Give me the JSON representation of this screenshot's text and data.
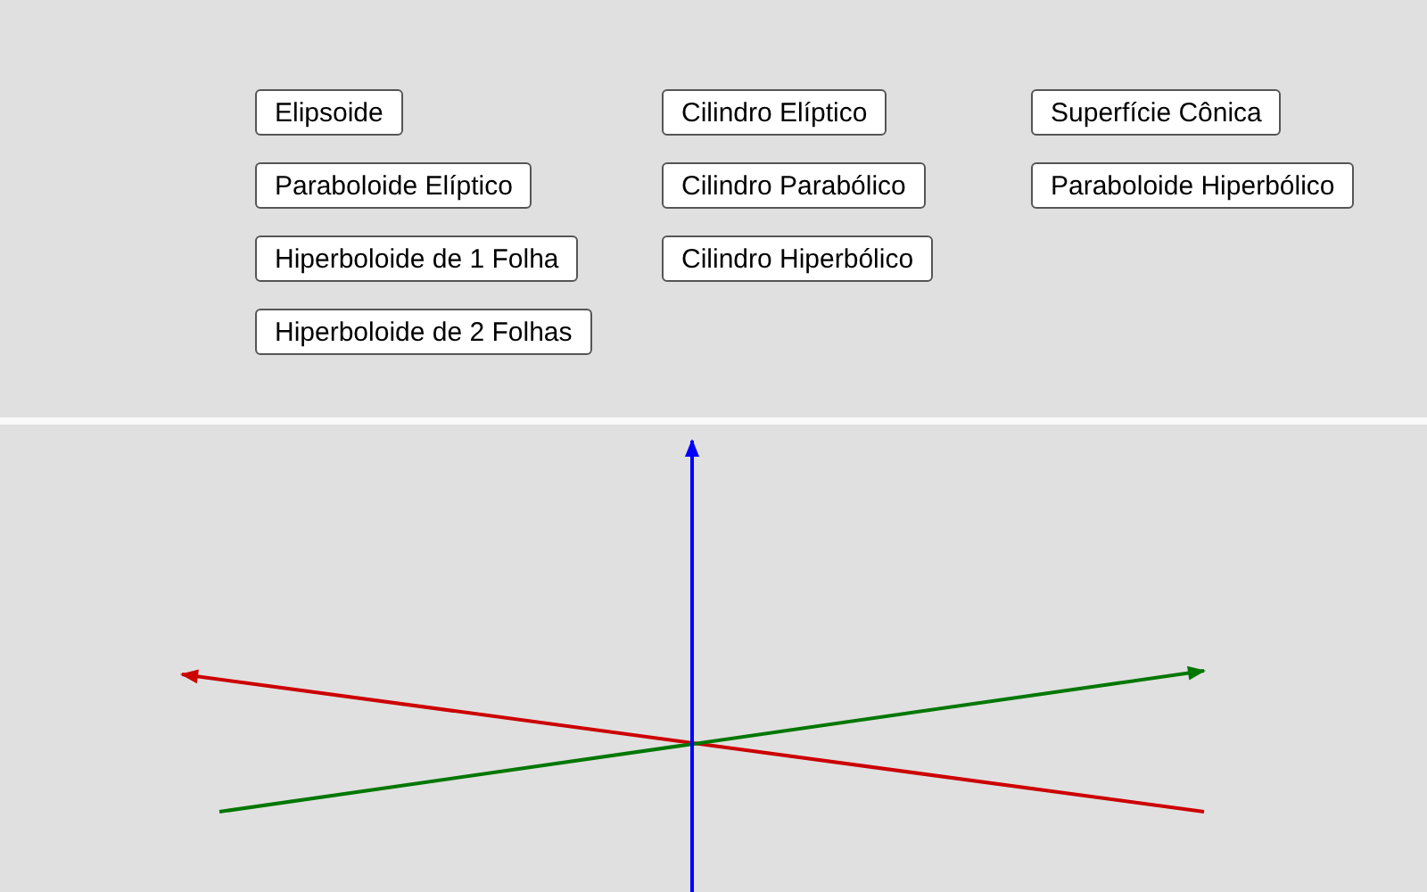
{
  "button_columns": [
    {
      "buttons": [
        "Elipsoide",
        "Paraboloide Elíptico",
        "Hiperboloide de 1 Folha",
        "Hiperboloide de 2 Folhas"
      ]
    },
    {
      "buttons": [
        "Cilindro Elíptico",
        "Cilindro Parabólico",
        "Cilindro Hiperbólico"
      ]
    },
    {
      "buttons": [
        "Superfície Cônica",
        "Paraboloide Hiperbólico"
      ]
    }
  ]
}
